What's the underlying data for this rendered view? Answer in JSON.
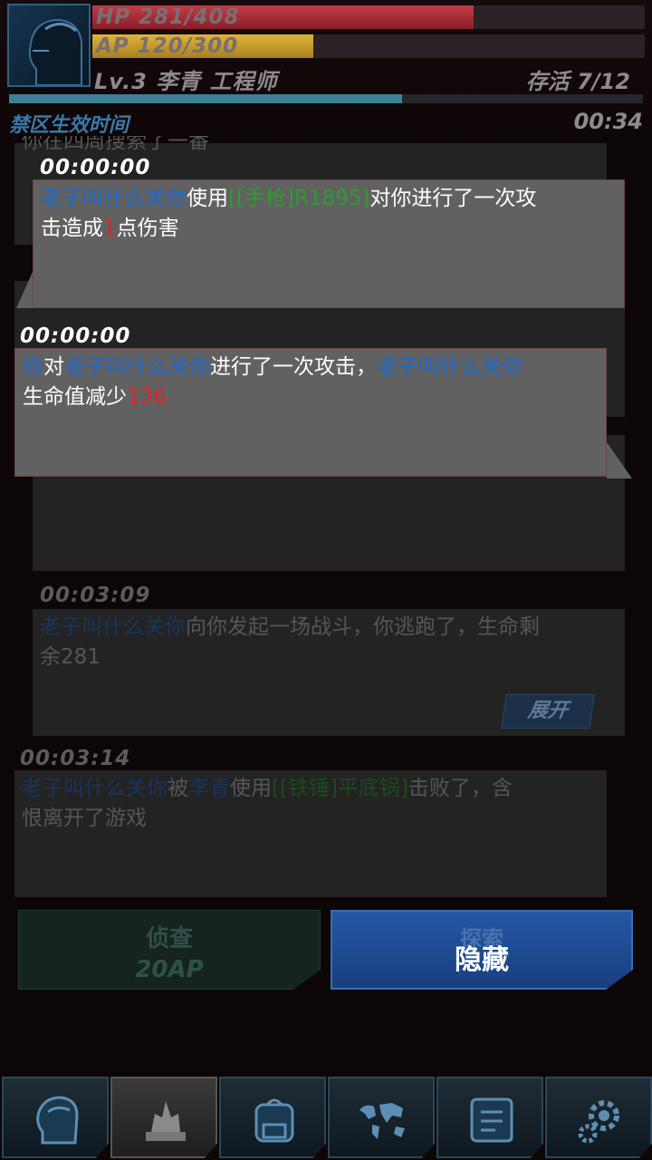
{
  "player": {
    "hp_text": "HP 281/408",
    "hp_fraction": 0.69,
    "ap_text": "AP 120/300",
    "ap_fraction": 0.4,
    "info": "Lv.3  李青  工程师",
    "survivors": "存活 7/12"
  },
  "zone": {
    "label": "禁区生效时间",
    "timer": "00:34",
    "progress_fraction": 0.62
  },
  "log": {
    "peek_text": "你在四周搜索了一番",
    "entry3": {
      "time": "00:03:09",
      "name": "老子叫什么关你",
      "text": "向你发起一场战斗，你逃跑了，生命剩",
      "text2": "余281",
      "expand": "展开"
    },
    "entry4": {
      "time": "00:03:14",
      "name1": "老子叫什么关你",
      "mid": "被",
      "name2": "李青",
      "mid2": "使用",
      "weapon": "[[铁锤]平底锅]",
      "text": "击败了，含",
      "text2": "恨离开了游戏"
    }
  },
  "popup1": {
    "time": "00:00:00",
    "name": "老子叫什么关你",
    "verb": "使用",
    "weapon": "[[手枪]R1895]",
    "text1": "对你进行了一次攻",
    "text2": "击造成",
    "damage": "1",
    "text3": "点伤害"
  },
  "popup2": {
    "time": "00:00:00",
    "subject": "你",
    "verb": "对",
    "target": "老子叫什么关你",
    "text1": "进行了一次攻击，",
    "target2": "老子叫什么关你",
    "text2": "生命值减少",
    "damage": "136"
  },
  "actions": {
    "scout_label": "侦查",
    "scout_cost": "20AP",
    "hide_ghost": "探索",
    "hide_label": "隐藏"
  },
  "nav": {
    "items": [
      "character-icon",
      "chess-icon",
      "backpack-icon",
      "world-map-icon",
      "scroll-icon",
      "settings-icon"
    ]
  },
  "colors": {
    "hp": "#c23c47",
    "ap": "#e0b43a",
    "name_blue": "#2a6ec4",
    "weapon_green": "#3d9a38",
    "damage_red": "#d3222a",
    "accent_blue": "#2458a4"
  }
}
